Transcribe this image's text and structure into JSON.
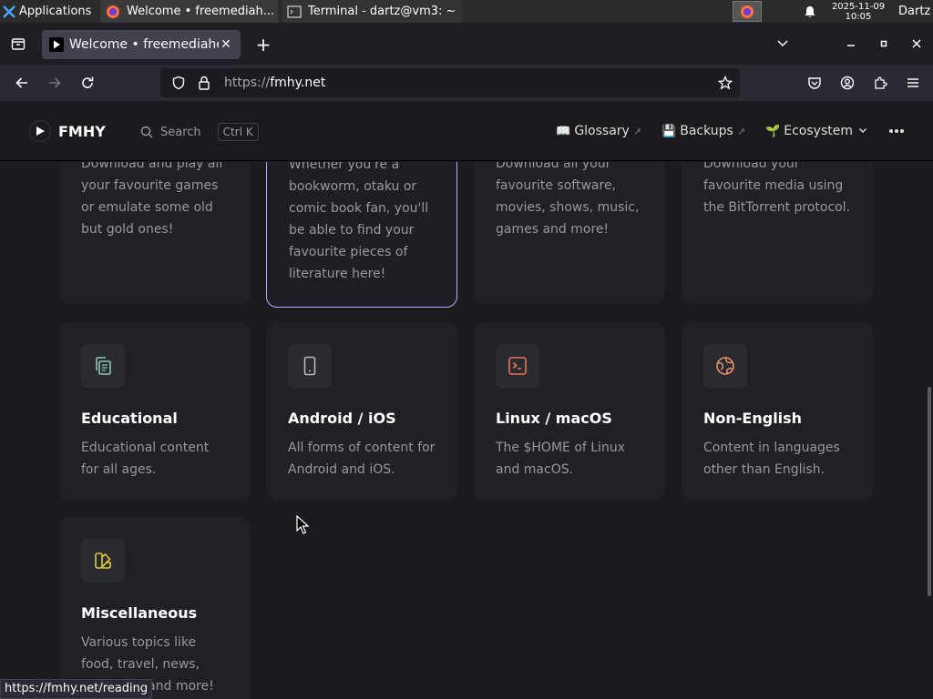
{
  "taskbar": {
    "applications_label": "Applications",
    "tasks": [
      {
        "label": "Welcome • freemediah...",
        "icon": "firefox-icon"
      },
      {
        "label": "Terminal - dartz@vm3: ~",
        "icon": "terminal-icon"
      }
    ],
    "clock_date": "2025-11-09",
    "clock_time": "10:05",
    "user": "Dartz"
  },
  "browser": {
    "tab_title": "Welcome • freemediaheckyeah",
    "url_prefix": "https://",
    "url_host": "fmhy.net",
    "status_link": "https://fmhy.net/reading"
  },
  "site": {
    "logo_text": "FMHY",
    "search_label": "Search",
    "search_shortcut": "Ctrl K",
    "nav": [
      {
        "emoji": "📖",
        "label": "Glossary",
        "external": "↗"
      },
      {
        "emoji": "💾",
        "label": "Backups",
        "external": "↗"
      },
      {
        "emoji": "🌱",
        "label": "Ecosystem"
      }
    ]
  },
  "top_cards": [
    {
      "desc": "Download and play all your favourite games or emulate some old but gold ones!"
    },
    {
      "desc": "Whether you're a bookworm, otaku or comic book fan, you'll be able to find your favourite pieces of literature here!"
    },
    {
      "desc": "Download all your favourite software, movies, shows, music, games and more!"
    },
    {
      "desc": "Download your favourite media using the BitTorrent protocol."
    }
  ],
  "cards": [
    {
      "title": "Educational",
      "desc": "Educational content for all ages.",
      "icon": "copy-icon",
      "color": "#8ec8b4"
    },
    {
      "title": "Android / iOS",
      "desc": "All forms of content for Android and iOS.",
      "icon": "phone-icon",
      "color": "#98989f"
    },
    {
      "title": "Linux / macOS",
      "desc": "The $HOME of Linux and macOS.",
      "icon": "terminal-icon",
      "color": "#e8765a"
    },
    {
      "title": "Non-English",
      "desc": "Content in languages other than English.",
      "icon": "globe-icon",
      "color": "#e8906a"
    },
    {
      "title": "Miscellaneous",
      "desc": "Various topics like food, travel, news, shopping, and more!",
      "icon": "swatch-icon",
      "color": "#e0c93c"
    }
  ]
}
